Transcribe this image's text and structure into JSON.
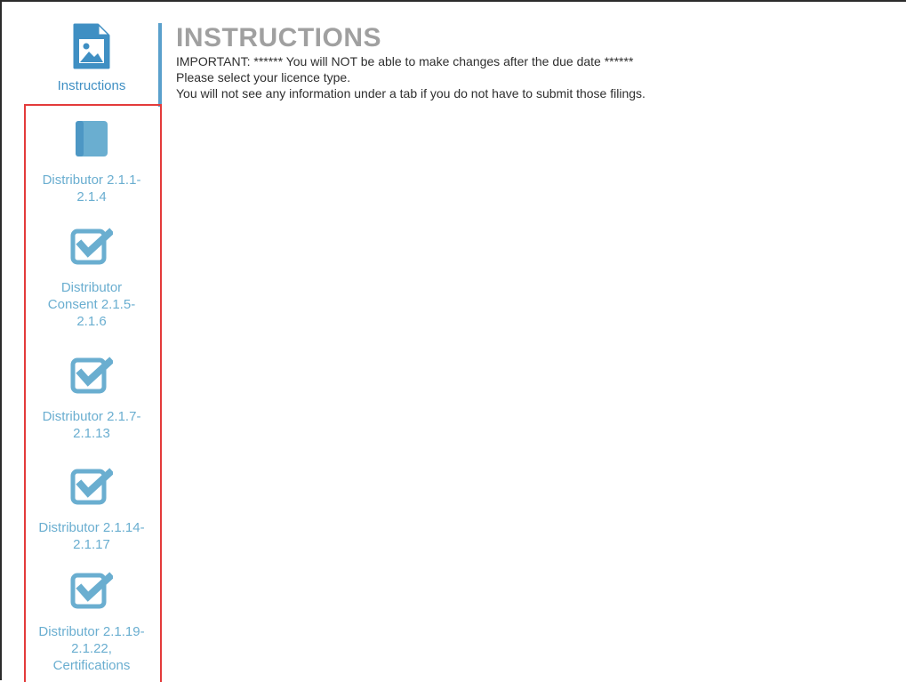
{
  "sidebar": {
    "items": [
      {
        "label": "Instructions",
        "icon": "image-file-icon",
        "active": true
      },
      {
        "label": "Distributor 2.1.1-\n2.1.4",
        "icon": "book-icon"
      },
      {
        "label": "Distributor\nConsent 2.1.5-\n2.1.6",
        "icon": "checkbox-checked-icon"
      },
      {
        "label": "Distributor 2.1.7-\n2.1.13",
        "icon": "checkbox-checked-icon"
      },
      {
        "label": "Distributor 2.1.14-\n2.1.17",
        "icon": "checkbox-checked-icon"
      },
      {
        "label": "Distributor 2.1.19-\n2.1.22,\nCertifications",
        "icon": "checkbox-checked-icon"
      }
    ]
  },
  "main": {
    "title": "INSTRUCTIONS",
    "lines": [
      "IMPORTANT: ****** You will NOT be able to make changes after the due date ******",
      "Please select your licence type.",
      "You will not see any information under a tab if you do not have to submit those filings."
    ]
  },
  "colors": {
    "accent": "#5aa0cc",
    "nav_text": "#6aaed0",
    "title_text": "#a0a0a0",
    "highlight": "#e33b3b"
  }
}
